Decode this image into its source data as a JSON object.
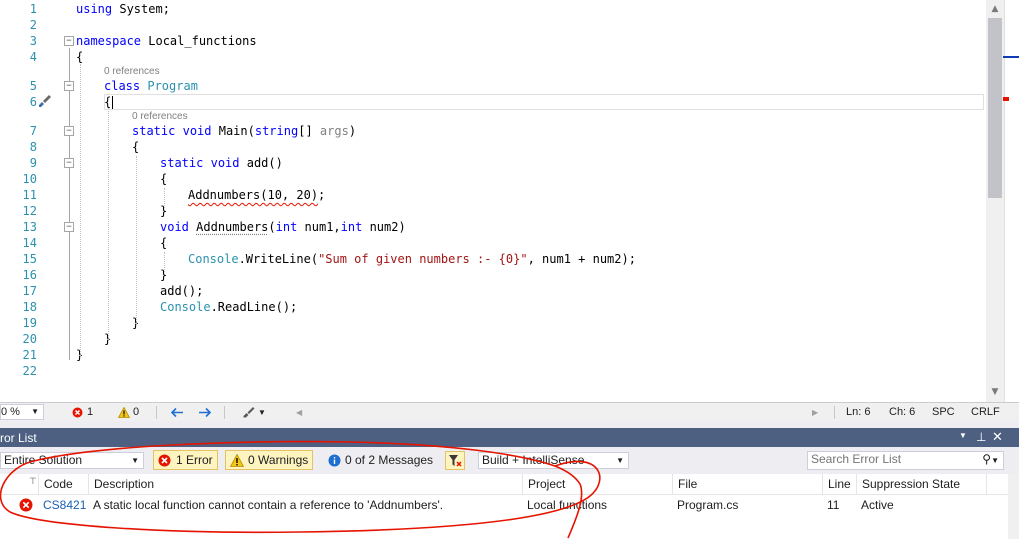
{
  "editor": {
    "lines": [
      {
        "n": "1",
        "tokens": [
          {
            "t": "using",
            "c": "kw"
          },
          {
            "t": " System;"
          }
        ]
      },
      {
        "n": "2",
        "tokens": []
      },
      {
        "n": "3",
        "tokens": [
          {
            "t": "namespace",
            "c": "kw"
          },
          {
            "t": " Local_functions"
          }
        ]
      },
      {
        "n": "4",
        "tokens": [
          {
            "t": "{"
          }
        ]
      },
      {
        "n": "5",
        "tokens": [
          {
            "t": "class",
            "c": "kw"
          },
          {
            "t": " "
          },
          {
            "t": "Program",
            "c": "ty"
          }
        ]
      },
      {
        "n": "6",
        "tokens": [
          {
            "t": "{"
          }
        ]
      },
      {
        "n": "7",
        "tokens": [
          {
            "t": "static",
            "c": "kw"
          },
          {
            "t": " "
          },
          {
            "t": "void",
            "c": "kw"
          },
          {
            "t": " Main("
          },
          {
            "t": "string",
            "c": "kw"
          },
          {
            "t": "[] "
          },
          {
            "t": "args",
            "c": "pm"
          },
          {
            "t": ")"
          }
        ]
      },
      {
        "n": "8",
        "tokens": [
          {
            "t": "{"
          }
        ]
      },
      {
        "n": "9",
        "tokens": [
          {
            "t": "static",
            "c": "kw"
          },
          {
            "t": " "
          },
          {
            "t": "void",
            "c": "kw"
          },
          {
            "t": " add()"
          }
        ]
      },
      {
        "n": "10",
        "tokens": [
          {
            "t": "{"
          }
        ]
      },
      {
        "n": "11",
        "tokens": [
          {
            "t": "Addnumbers(10, 20)",
            "c": "squig"
          },
          {
            "t": ";"
          }
        ]
      },
      {
        "n": "12",
        "tokens": [
          {
            "t": "}"
          }
        ]
      },
      {
        "n": "13",
        "tokens": [
          {
            "t": "void",
            "c": "kw"
          },
          {
            "t": " "
          },
          {
            "t": "Addnumbers",
            "c": "squig-g"
          },
          {
            "t": "("
          },
          {
            "t": "int",
            "c": "kw"
          },
          {
            "t": " num1,"
          },
          {
            "t": "int",
            "c": "kw"
          },
          {
            "t": " num2)"
          }
        ]
      },
      {
        "n": "14",
        "tokens": [
          {
            "t": "{"
          }
        ]
      },
      {
        "n": "15",
        "tokens": [
          {
            "t": "Console",
            "c": "ty"
          },
          {
            "t": ".WriteLine("
          },
          {
            "t": "\"Sum of given numbers :- {0}\"",
            "c": "st"
          },
          {
            "t": ", num1 + num2);"
          }
        ]
      },
      {
        "n": "16",
        "tokens": [
          {
            "t": "}"
          }
        ]
      },
      {
        "n": "17",
        "tokens": [
          {
            "t": "add();"
          }
        ]
      },
      {
        "n": "18",
        "tokens": [
          {
            "t": "Console",
            "c": "ty"
          },
          {
            "t": ".ReadLine();"
          }
        ]
      },
      {
        "n": "19",
        "tokens": [
          {
            "t": "}"
          }
        ]
      },
      {
        "n": "20",
        "tokens": [
          {
            "t": "}"
          }
        ]
      },
      {
        "n": "21",
        "tokens": [
          {
            "t": "}"
          }
        ]
      },
      {
        "n": "22",
        "tokens": []
      }
    ],
    "codelens": [
      "0 references",
      "0 references"
    ]
  },
  "status": {
    "zoom": "0 %",
    "errors": "1",
    "warnings": "0",
    "ln": "Ln: 6",
    "ch": "Ch: 6",
    "spc": "SPC",
    "crlf": "CRLF"
  },
  "error_list": {
    "title": "ror List",
    "scope": "Entire Solution",
    "errors_filter": "1 Error",
    "warnings_filter": "0 Warnings",
    "messages_filter": "0 of 2 Messages",
    "build_filter": "Build + IntelliSense",
    "search_placeholder": "Search Error List",
    "columns": {
      "code": "Code",
      "description": "Description",
      "project": "Project",
      "file": "File",
      "line": "Line",
      "suppression": "Suppression State"
    },
    "rows": [
      {
        "code": "CS8421",
        "description": "A static local function cannot contain a reference to 'Addnumbers'.",
        "project": "Local functions",
        "file": "Program.cs",
        "line": "11",
        "suppression": "Active"
      }
    ]
  },
  "colors": {
    "panel_title": "#4d6082",
    "error_red": "#e51400",
    "link_blue": "#1a5fb4"
  }
}
